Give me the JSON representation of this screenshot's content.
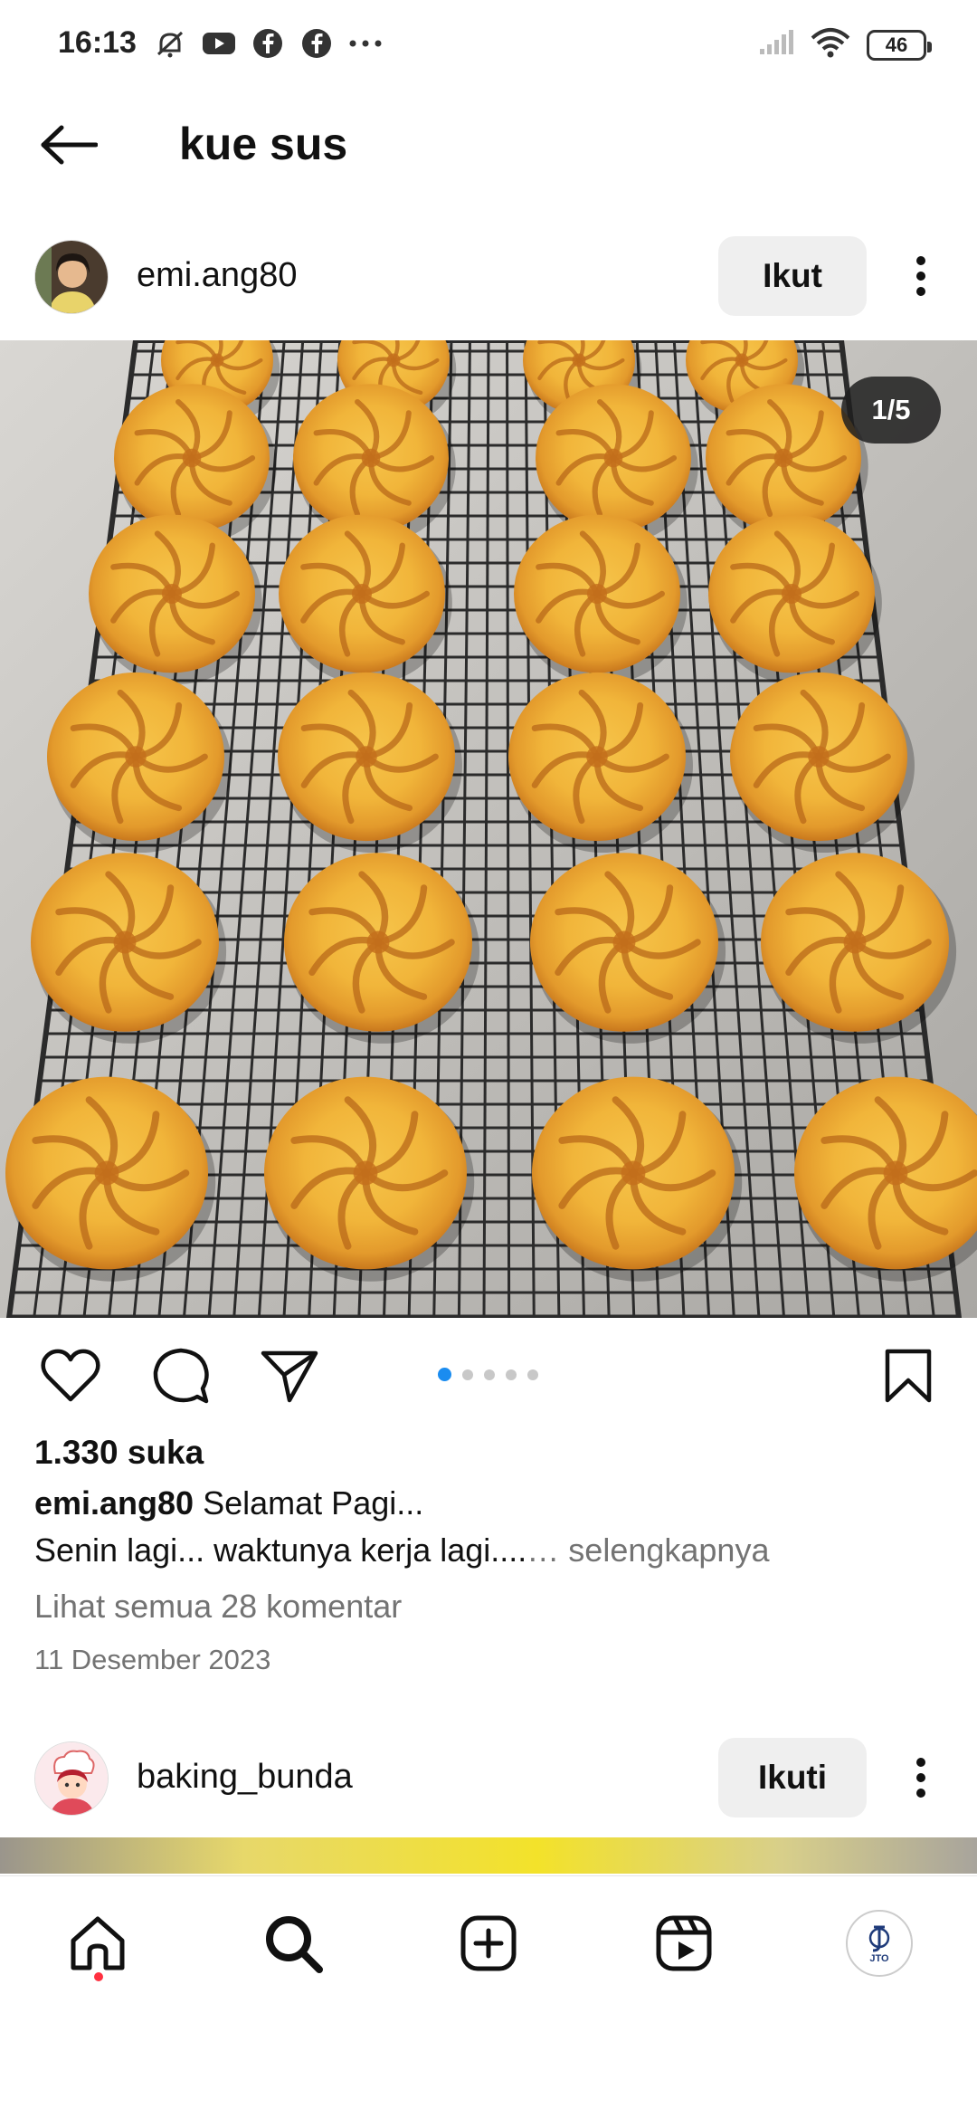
{
  "status_bar": {
    "time": "16:13",
    "battery": "46",
    "left_icons": [
      "mute-icon",
      "youtube-icon",
      "facebook-icon",
      "facebook-icon",
      "more-dots-icon"
    ],
    "right_icons": [
      "signal-icon",
      "wifi-icon",
      "battery-icon"
    ]
  },
  "top_bar": {
    "title": "kue sus",
    "back_icon": "back-arrow-icon"
  },
  "post": {
    "username": "emi.ang80",
    "follow_label": "Ikut",
    "image_counter": "1/5",
    "carousel": {
      "count": 5,
      "active_index": 0
    },
    "likes": "1.330 suka",
    "caption_user": "emi.ang80",
    "caption_text": "Selamat Pagi...",
    "caption_line2": "Senin lagi... waktunya kerja lagi....",
    "caption_more": "… selengkapnya",
    "view_comments": "Lihat semua 28 komentar",
    "date": "11 Desember 2023",
    "actions": [
      "heart-icon",
      "comment-icon",
      "share-icon",
      "bookmark-icon"
    ]
  },
  "next_post": {
    "username": "baking_bunda",
    "follow_label": "Ikuti"
  },
  "bottom_nav": {
    "items": [
      "home-icon",
      "search-icon",
      "create-icon",
      "reels-icon",
      "profile-avatar"
    ],
    "profile_text": "JTO"
  },
  "colors": {
    "accent": "#1a8cf0",
    "notification": "#ff3040",
    "muted_text": "#737373",
    "button_bg": "#efefef"
  }
}
